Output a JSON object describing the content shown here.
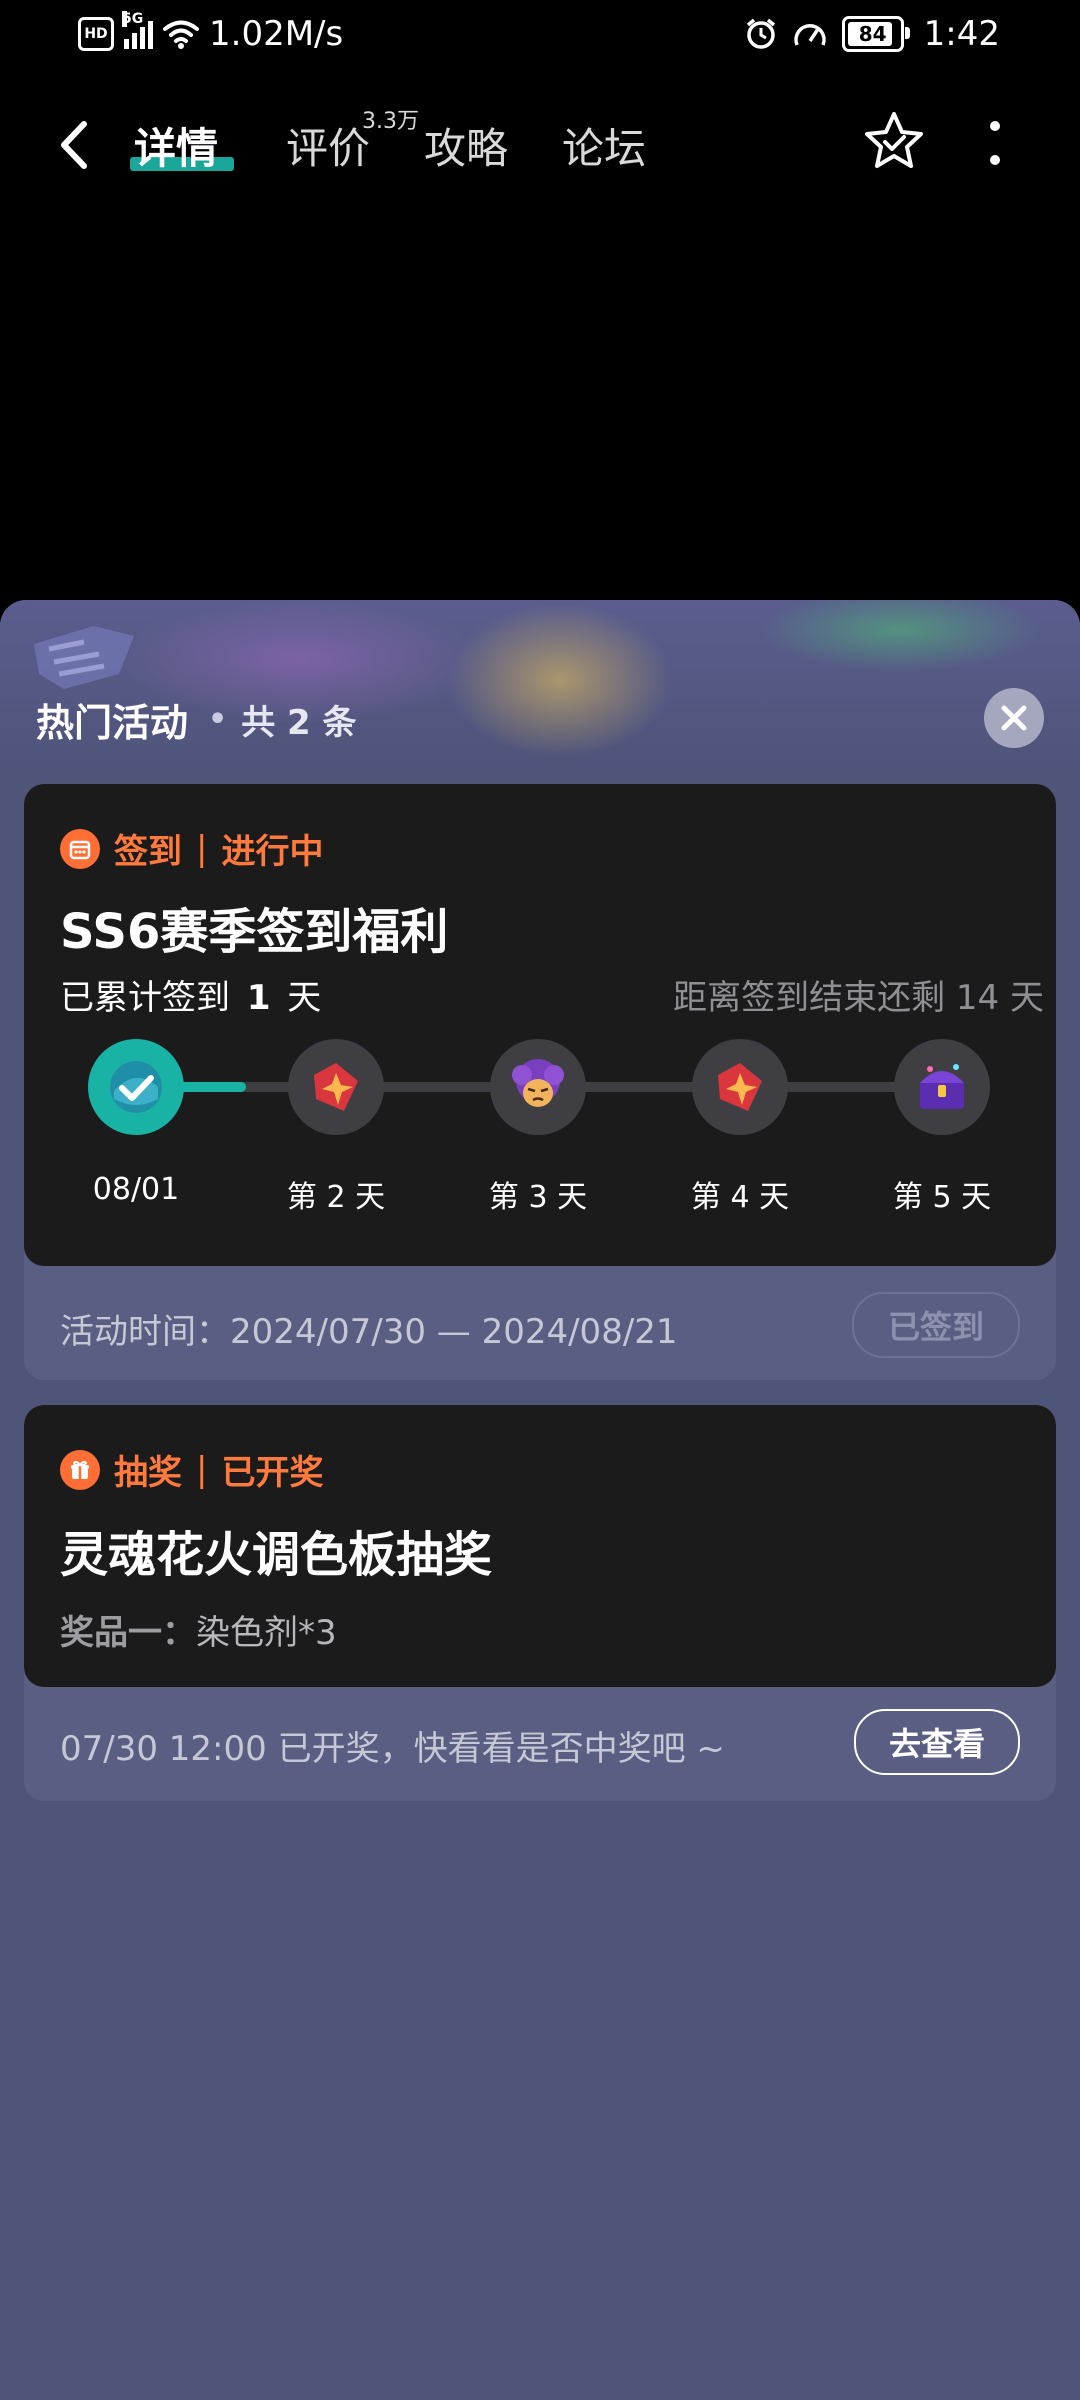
{
  "status_bar": {
    "hd": "HD",
    "network": "5G",
    "speed": "1.02M/s",
    "battery": "84",
    "time": "1:42"
  },
  "nav": {
    "tabs": [
      {
        "label": "详情",
        "active": true
      },
      {
        "label": "评价",
        "badge": "3.3万"
      },
      {
        "label": "攻略"
      },
      {
        "label": "论坛"
      }
    ]
  },
  "sheet": {
    "title": "热门活动",
    "dot": "•",
    "count": "共 2 条"
  },
  "activities": [
    {
      "tag": "签到",
      "sep": "|",
      "status": "进行中",
      "title": "SS6赛季签到福利",
      "progress_prefix": "已累计签到",
      "progress_days": "1",
      "progress_suffix": "天",
      "remaining": "距离签到结束还剩 14 天",
      "days": [
        {
          "label": "08/01",
          "done": true,
          "icon": "check-icon"
        },
        {
          "label": "第 2 天",
          "done": false,
          "icon": "red-gem-card-icon"
        },
        {
          "label": "第 3 天",
          "done": false,
          "icon": "character-avatar-icon"
        },
        {
          "label": "第 4 天",
          "done": false,
          "icon": "red-gem-card-icon"
        },
        {
          "label": "第 5 天",
          "done": false,
          "icon": "treasure-chest-icon"
        }
      ],
      "footer": "活动时间：2024/07/30 — 2024/08/21",
      "button": "已签到"
    },
    {
      "tag": "抽奖",
      "sep": "|",
      "status": "已开奖",
      "title": "灵魂花火调色板抽奖",
      "prize_label": "奖品一：",
      "prize_value": "染色剂*3",
      "footer": "07/30 12:00 已开奖，快看看是否中奖吧 ~",
      "button": "去查看"
    }
  ],
  "colors": {
    "accent_orange": "#ff7a3c",
    "accent_teal": "#19b3a5",
    "sheet_bg": "#4f5479",
    "card_bg": "#1b1b1c"
  }
}
